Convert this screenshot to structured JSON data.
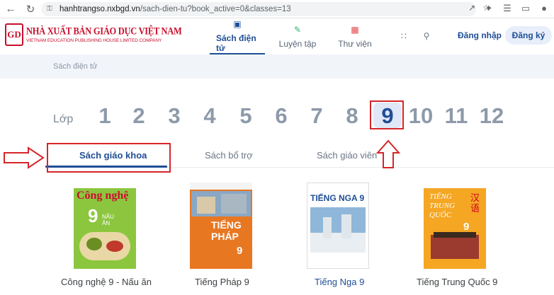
{
  "browser": {
    "url_host": "hanhtrangso.nxbgd.vn",
    "url_path": "/sach-dien-tu?book_active=0&classes=13"
  },
  "header": {
    "logo_mark": "GD",
    "logo_main": "NHÀ XUẤT BẢN GIÁO DỤC VIỆT NAM",
    "logo_sub": "VIETNAM EDUCATION PUBLISHING HOUSE LIMITED COMPANY",
    "tabs": [
      {
        "label": "Sách điện tử",
        "active": true
      },
      {
        "label": "Luyện tập",
        "active": false
      },
      {
        "label": "Thư viện",
        "active": false
      }
    ],
    "login_label": "Đăng nhập",
    "register_label": "Đăng ký"
  },
  "breadcrumb": "Sách điện tử",
  "grades": {
    "label": "Lớp",
    "items": [
      "1",
      "2",
      "3",
      "4",
      "5",
      "6",
      "7",
      "8",
      "9",
      "10",
      "11",
      "12"
    ],
    "selected": "9"
  },
  "book_tabs": [
    {
      "label": "Sách giáo khoa",
      "active": true
    },
    {
      "label": "Sách bổ trợ",
      "active": false
    },
    {
      "label": "Sách giáo viên",
      "active": false
    }
  ],
  "books": [
    {
      "title": "Công nghệ 9 - Nấu ăn",
      "cover_title": "Công nghệ",
      "cover_num": "9",
      "cover_sub": "NẤU ĂN",
      "highlight": false
    },
    {
      "title": "Tiếng Pháp 9",
      "cover_title": "TIẾNG PHÁP",
      "cover_num": "9",
      "highlight": false
    },
    {
      "title": "Tiếng Nga 9",
      "cover_title": "TIẾNG NGA 9",
      "highlight": true
    },
    {
      "title": "Tiếng Trung Quốc 9",
      "cover_title": "TIẾNG TRUNG QUỐC",
      "cover_num": "9",
      "cover_cn": "汉语",
      "highlight": false
    }
  ],
  "colors": {
    "brand": "#c8102e",
    "primary": "#1f4e96",
    "annotation_red": "#d6252a"
  }
}
